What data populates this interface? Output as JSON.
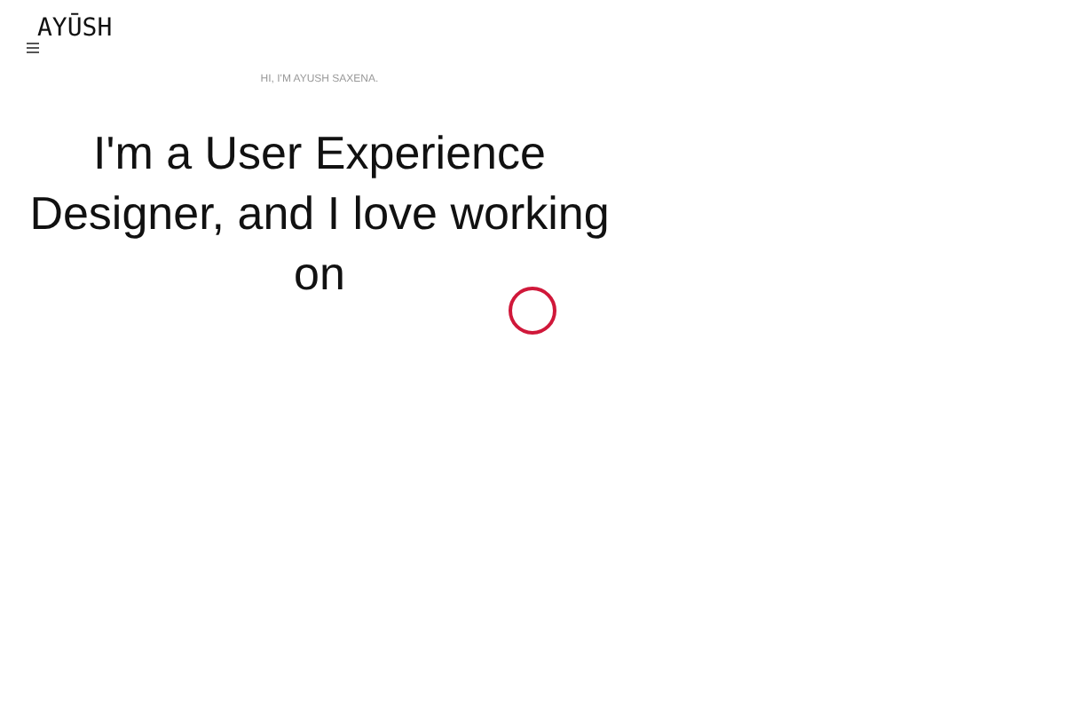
{
  "logo": "AYŪSH",
  "intro": "HI, I'M AYUSH SAXENA.",
  "headline": "I'm a User Experience Designer, and I love working on"
}
